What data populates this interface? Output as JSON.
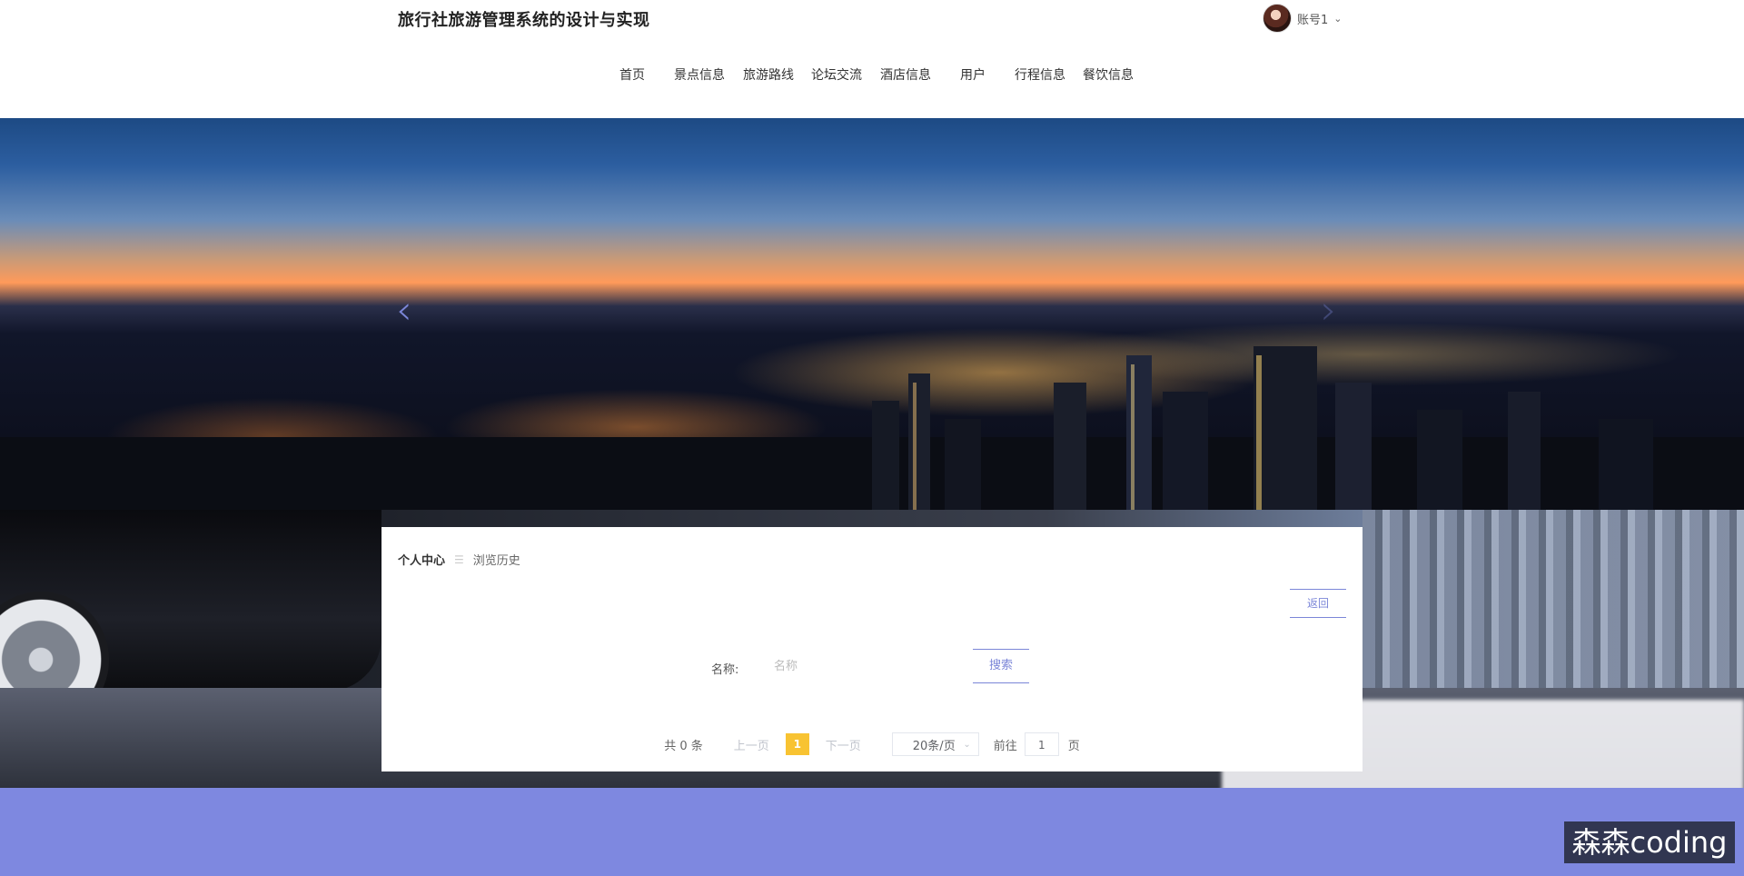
{
  "header": {
    "title": "旅行社旅游管理系统的设计与实现",
    "account": {
      "name": "账号1",
      "chevron_icon": "chevron-down-icon"
    }
  },
  "nav": {
    "items": [
      {
        "label": "首页"
      },
      {
        "label": "景点信息"
      },
      {
        "label": "旅游路线"
      },
      {
        "label": "论坛交流"
      },
      {
        "label": "酒店信息"
      },
      {
        "label": "用户"
      },
      {
        "label": "行程信息"
      },
      {
        "label": "餐饮信息"
      }
    ]
  },
  "carousel": {
    "prev_icon": "chevron-left-icon",
    "next_icon": "chevron-right-icon",
    "prev_glyph": "‹",
    "next_glyph": "›"
  },
  "breadcrumb": {
    "home": "个人中心",
    "separator": "☰",
    "current": "浏览历史"
  },
  "actions": {
    "back_label": "返回"
  },
  "search": {
    "label": "名称:",
    "placeholder": "名称",
    "value": "",
    "button_label": "搜索"
  },
  "pagination": {
    "total_text": "共 0 条",
    "prev_label": "上一页",
    "current_page": "1",
    "next_label": "下一页",
    "page_size": "20条/页",
    "goto_label": "前往",
    "goto_value": "1",
    "goto_suffix": "页"
  },
  "watermark": {
    "text": "森森coding"
  },
  "colors": {
    "accent": "#7b86d8",
    "footer": "#7e88e0",
    "active_page": "#f8c332"
  }
}
